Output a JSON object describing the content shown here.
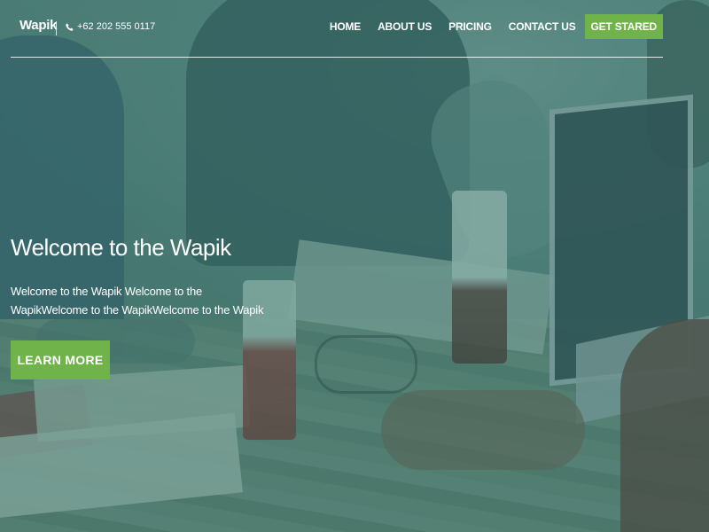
{
  "header": {
    "brand": "Wapik",
    "phone": "+62 202 555 0117",
    "nav": [
      "HOME",
      "ABOUT US",
      "PRICING",
      "CONTACT US"
    ],
    "cta": "GET STARED"
  },
  "hero": {
    "title": "Welcome to the Wapik",
    "subtitle": "Welcome to the Wapik Welcome to the WapikWelcome to the WapikWelcome to the Wapik",
    "button": "LEARN MORE"
  },
  "colors": {
    "accent": "#6fb34a",
    "overlay": "#38786e"
  },
  "icons": {
    "phone": "phone-icon"
  }
}
